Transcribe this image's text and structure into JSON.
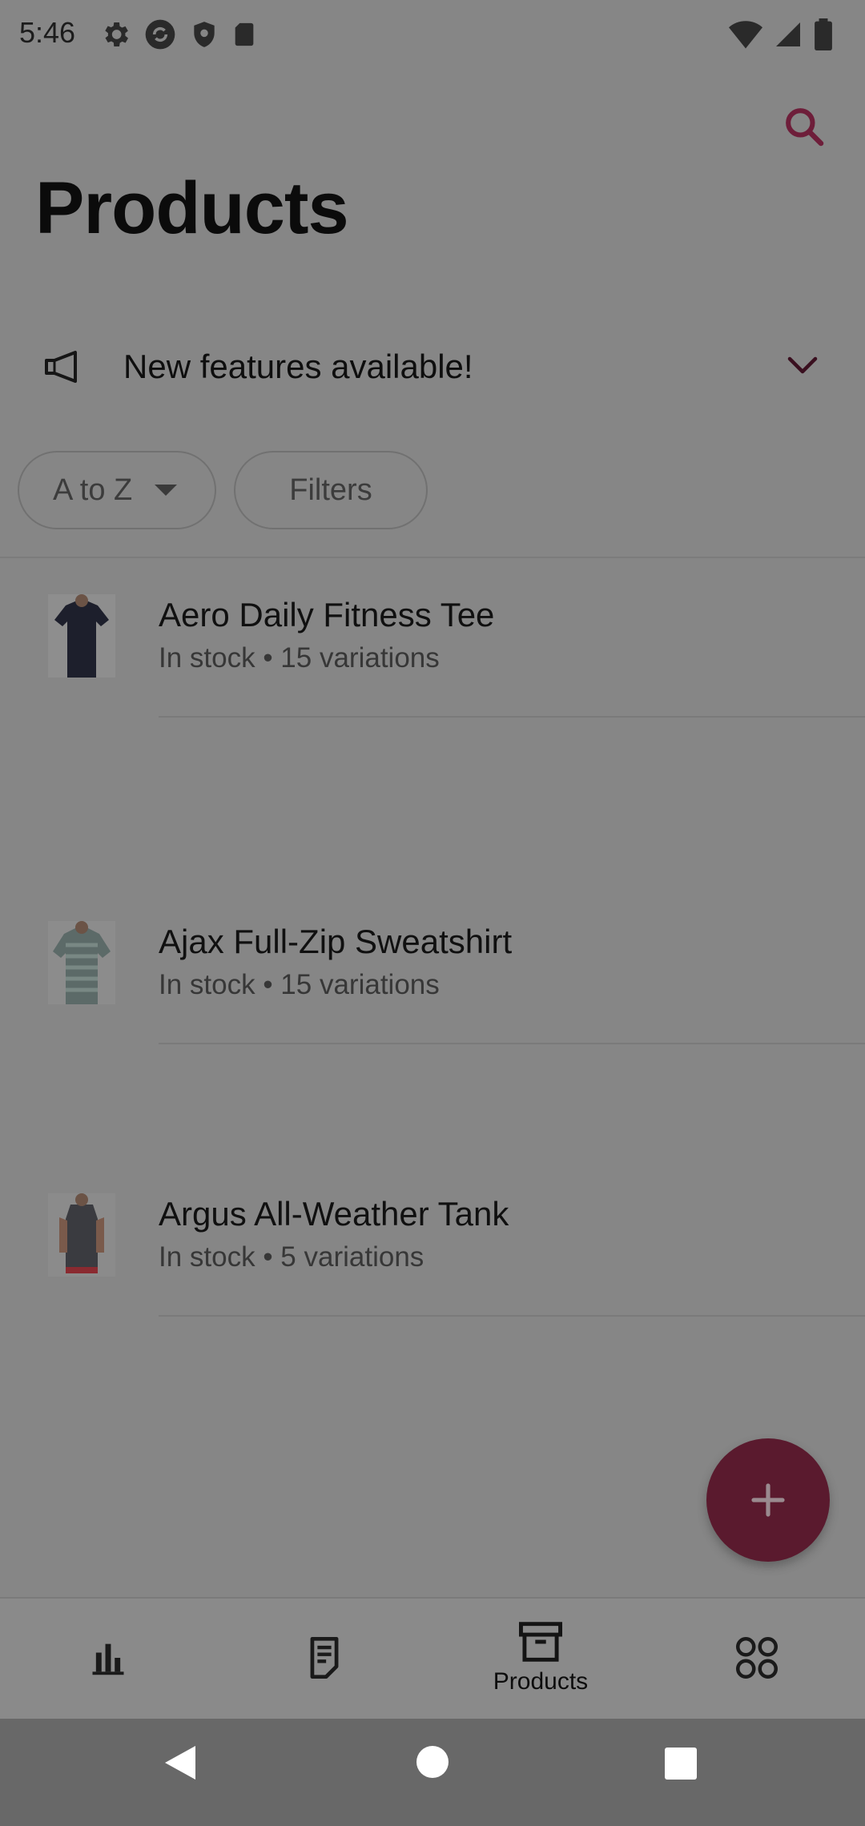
{
  "status_bar": {
    "time": "5:46",
    "left_icons": [
      "gear-icon",
      "sync-icon",
      "shield-icon",
      "sd-card-icon"
    ],
    "right_icons": [
      "wifi-icon",
      "signal-icon",
      "battery-icon"
    ]
  },
  "header": {
    "title": "Products",
    "search_icon": "search-icon"
  },
  "banner": {
    "icon": "megaphone-icon",
    "text": "New features available!",
    "chevron": "chevron-down-icon"
  },
  "filters": {
    "sort_label": "A to Z",
    "filters_label": "Filters"
  },
  "products": [
    {
      "name": "Aero Daily Fitness Tee",
      "meta": "In stock • 15 variations"
    },
    {
      "name": "Ajax Full-Zip Sweatshirt",
      "meta": "In stock • 15 variations"
    },
    {
      "name": "Argus All-Weather Tank",
      "meta": "In stock • 5 variations"
    }
  ],
  "fab": {
    "icon": "plus-icon"
  },
  "bottom_nav": {
    "items": [
      {
        "icon": "bar-chart-icon",
        "label": ""
      },
      {
        "icon": "orders-icon",
        "label": ""
      },
      {
        "icon": "archive-box-icon",
        "label": "Products"
      },
      {
        "icon": "grid-menu-icon",
        "label": ""
      }
    ]
  },
  "colors": {
    "scrim_background": "#868686",
    "accent": "#5a1a2e",
    "search_accent": "#6e1e3a"
  }
}
